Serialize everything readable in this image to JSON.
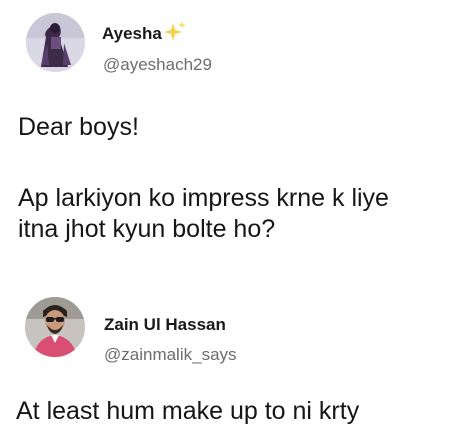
{
  "tweets": [
    {
      "display_name": "Ayesha",
      "handle": "@ayeshach29",
      "badge_icon": "sparkles-icon",
      "text_lines": [
        "Dear boys!",
        "Ap larkiyon ko impress krne k liye",
        "itna jhot kyun bolte ho?"
      ]
    },
    {
      "display_name": "Zain Ul Hassan",
      "handle": "@zainmalik_says",
      "text_lines": [
        "At least hum make up to ni krty"
      ]
    }
  ],
  "colors": {
    "name": "#1a1a1a",
    "handle": "#6d6d6d",
    "sparkle": "#f5d04a"
  }
}
